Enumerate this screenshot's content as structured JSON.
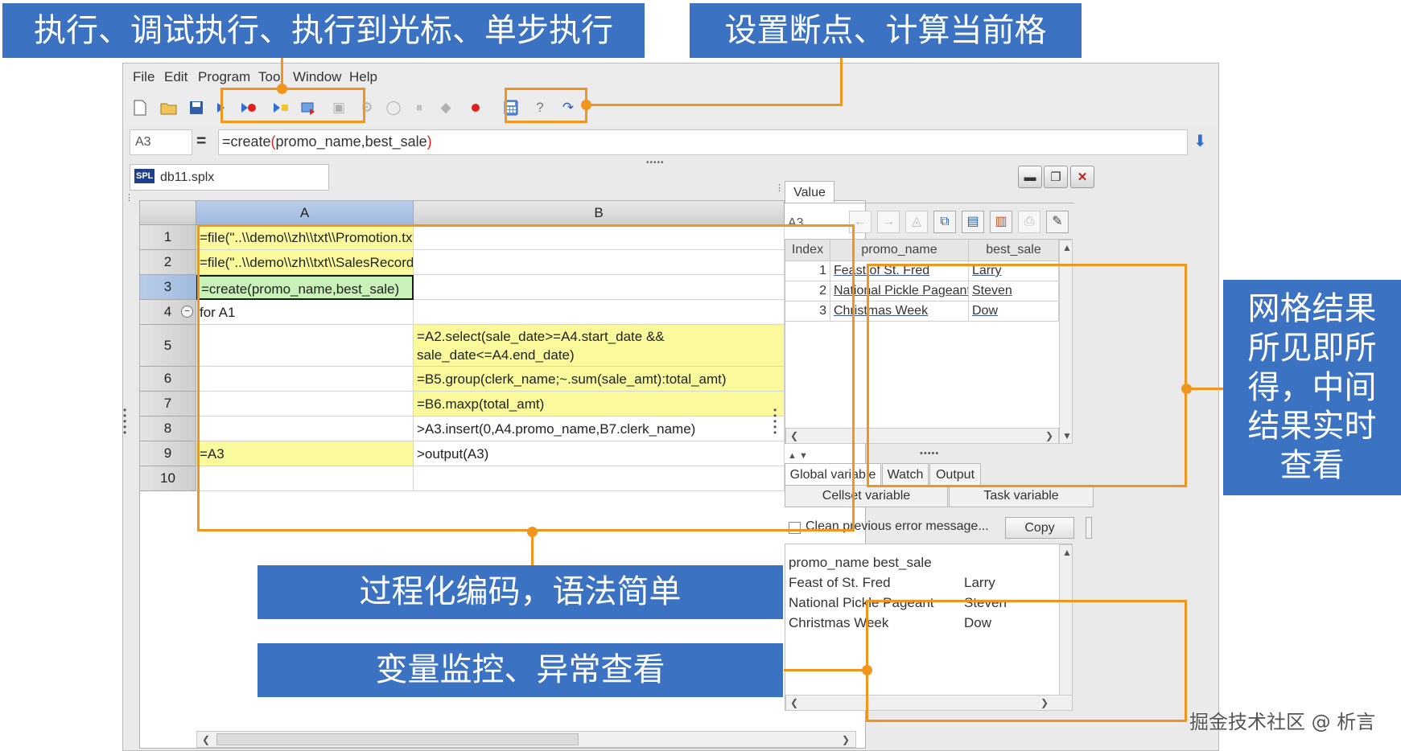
{
  "callouts": {
    "run": "执行、调试执行、执行到光标、单步执行",
    "breakpoint": "设置断点、计算当前格",
    "grid_result": "网格结果所见即所得，中间结果实时查看",
    "procedural": "过程化编码，语法简单",
    "variables": "变量监控、异常查看"
  },
  "menu": [
    "File",
    "Edit",
    "Program",
    "Tool",
    "Window",
    "Help"
  ],
  "toolbar_icons": [
    "new-file-icon",
    "open-folder-icon",
    "save-icon",
    "run-icon",
    "debug-run-icon",
    "run-to-cursor-icon",
    "step-icon",
    "breakpoint-icon",
    "calculate-cell-icon"
  ],
  "formula_bar": {
    "cell_ref": "A3",
    "equals": "=",
    "expr_prefix": "=create",
    "expr_open": "(",
    "expr_args": "promo_name,best_sale",
    "expr_close": ")"
  },
  "document": {
    "icon": "SPL",
    "name": "db11.splx"
  },
  "grid": {
    "columns": [
      "A",
      "B"
    ],
    "rows": [
      "1",
      "2",
      "3",
      "4",
      "5",
      "6",
      "7",
      "8",
      "9",
      "10"
    ],
    "cells": {
      "A1": "=file(\"..\\\\demo\\\\zh\\\\txt\\\\Promotion.txt\").import@t()",
      "A2": "=file(\"..\\\\demo\\\\zh\\\\txt\\\\SalesRecord.txt\").import@t()",
      "A3": "=create(promo_name,best_sale)",
      "A4": "for A1",
      "B5_line1": "=A2.select(sale_date>=A4.start_date &&",
      "B5_line2": "sale_date<=A4.end_date)",
      "B6": "=B5.group(clerk_name;~.sum(sale_amt):total_amt)",
      "B7": "=B6.maxp(total_amt)",
      "B8": ">A3.insert(0,A4.promo_name,B7.clerk_name)",
      "A9": "=A3",
      "B9": ">output(A3)"
    }
  },
  "value_panel": {
    "tab": "Value",
    "cell_ref": "A3",
    "headers": [
      "Index",
      "promo_name",
      "best_sale"
    ],
    "rows": [
      {
        "index": "1",
        "promo_name": "Feast of St. Fred",
        "best_sale": "Larry"
      },
      {
        "index": "2",
        "promo_name": "National Pickle Pageant",
        "best_sale": "Steven"
      },
      {
        "index": "3",
        "promo_name": "Christmas Week",
        "best_sale": "Dow"
      }
    ]
  },
  "bottom_panel": {
    "tabs": [
      "Global variable",
      "Watch",
      "Output"
    ],
    "subtabs": [
      "Cellset variable",
      "Task variable"
    ],
    "checkbox_label": "Clean previous error message...",
    "copy_label": "Copy",
    "output_header": "promo_name best_sale",
    "output_rows": [
      {
        "name": "Feast of St. Fred",
        "value": "Larry"
      },
      {
        "name": "National Pickle Pageant",
        "value": "Steven"
      },
      {
        "name": "Christmas Week",
        "value": "Dow"
      }
    ]
  },
  "watermark": "掘金技术社区 @ 析言",
  "colors": {
    "callout_blue": "#3c72c2",
    "highlight_orange": "#f0961e",
    "cell_yellow": "#fafa9c",
    "cell_green": "#c8f2b8",
    "breakpoint_red": "#e02020"
  }
}
